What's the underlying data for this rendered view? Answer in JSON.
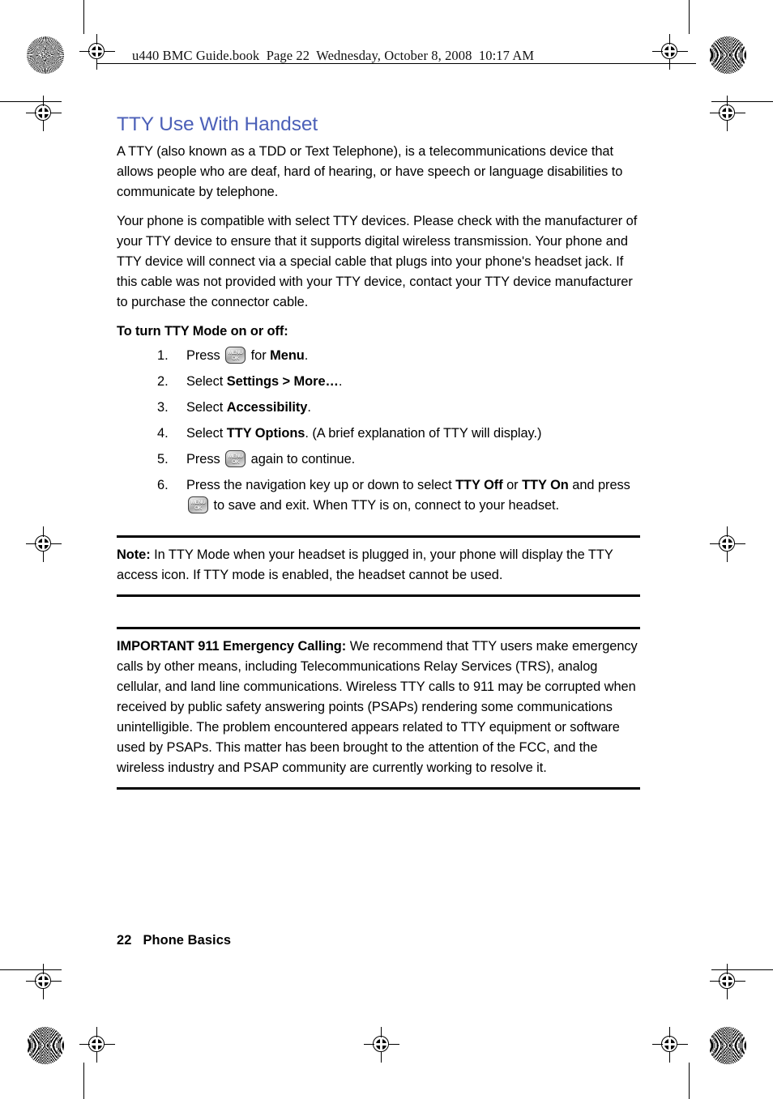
{
  "header": {
    "file_line": "u440 BMC Guide.book  Page 22  Wednesday, October 8, 2008  10:17 AM"
  },
  "section": {
    "title": "TTY Use With Handset",
    "title_color": "#4c60b8",
    "paragraphs": [
      "A TTY (also known as a TDD or Text Telephone), is a telecommunications device that allows people who are deaf, hard of hearing, or have speech or language disabilities to communicate by telephone.",
      "Your phone is compatible with select TTY devices. Please check with the manufacturer of your TTY device to ensure that it supports digital wireless transmission. Your phone and TTY device will connect via a special cable that plugs into your phone's headset jack. If this cable was not provided with your TTY device, contact your TTY device manufacturer to purchase the connector cable."
    ]
  },
  "procedure": {
    "heading": "To turn TTY Mode on or off:",
    "steps": [
      {
        "num": "1.",
        "pre": "Press ",
        "has_key": true,
        "key": {
          "line1": "MENU",
          "line2": "OK"
        },
        "mid": " for ",
        "bold1": "Menu",
        "post": "."
      },
      {
        "num": "2.",
        "pre": "Select ",
        "has_key": false,
        "bold1": "Settings > More…",
        "post": "."
      },
      {
        "num": "3.",
        "pre": "Select ",
        "has_key": false,
        "bold1": "Accessibility",
        "post": "."
      },
      {
        "num": "4.",
        "pre": "Select ",
        "has_key": false,
        "bold1": "TTY Options",
        "post": ". (A brief explanation of TTY will display.)"
      },
      {
        "num": "5.",
        "pre": "Press ",
        "has_key": true,
        "key": {
          "line1": "MENU",
          "line2": "OK"
        },
        "mid": " again to continue.",
        "bold1": "",
        "post": ""
      },
      {
        "num": "6.",
        "pre": "Press the navigation key up or down to select ",
        "has_key": true,
        "bold1": "TTY Off",
        "mid2": " or ",
        "bold2": "TTY On",
        "mid": " and press ",
        "key": {
          "line1": "MENU",
          "line2": "OK"
        },
        "post": " to save and exit. When TTY is on, connect to your headset."
      }
    ]
  },
  "note": {
    "label": "Note:",
    "text": " In TTY Mode when your headset is plugged in, your phone will display the TTY access icon. If TTY mode is enabled, the headset cannot be used."
  },
  "important": {
    "label": "IMPORTANT 911 Emergency Calling:",
    "text": " We recommend that TTY users make emergency calls by other means, including Telecommunications Relay Services (TRS), analog cellular, and land line communications. Wireless TTY calls to 911 may be corrupted when received by public safety answering points (PSAPs) rendering some communications unintelligible. The problem encountered appears related to TTY equipment or software used by PSAPs. This matter has been brought to the attention of the FCC, and the wireless industry and PSAP community are currently working to resolve it."
  },
  "footer": {
    "page_number": "22",
    "chapter": "Phone Basics"
  }
}
